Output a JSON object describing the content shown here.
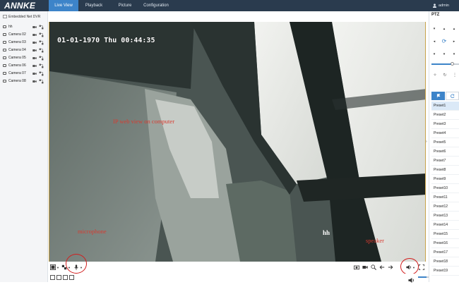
{
  "header": {
    "logo": "ANNKE",
    "tabs": [
      {
        "label": "Live View",
        "active": true
      },
      {
        "label": "Playback",
        "active": false
      },
      {
        "label": "Picture",
        "active": false
      },
      {
        "label": "Configuration",
        "active": false
      }
    ],
    "user": "admin"
  },
  "sidebar": {
    "device": "Embedded Net DVR",
    "cameras": [
      "hh",
      "Camera 02",
      "Camera 03",
      "Camera 04",
      "Camera 05",
      "Camera 06",
      "Camera 07",
      "Camera 08"
    ]
  },
  "video": {
    "osd": "01-01-1970 Thu 00:44:35",
    "channel_name": "hh",
    "annotations": {
      "web_view": "IP web view on computer",
      "microphone": "microphone",
      "speaker": "speaker"
    }
  },
  "ptz": {
    "title": "PTZ",
    "speed_level": 0.75,
    "preset_tab_active": "preset-list-icon",
    "preset_tab_other": "patrol-icon",
    "presets": [
      "Preset1",
      "Preset2",
      "Preset3",
      "Preset4",
      "Preset5",
      "Preset6",
      "Preset7",
      "Preset8",
      "Preset9",
      "Preset10",
      "Preset11",
      "Preset12",
      "Preset13",
      "Preset14",
      "Preset15",
      "Preset16",
      "Preset17",
      "Preset18",
      "Preset19"
    ]
  },
  "volume": {
    "level": 0.3
  },
  "colors": {
    "topbar": "#2a3b4e",
    "accent": "#3d84c9",
    "annotation_red": "#d83a2f"
  }
}
